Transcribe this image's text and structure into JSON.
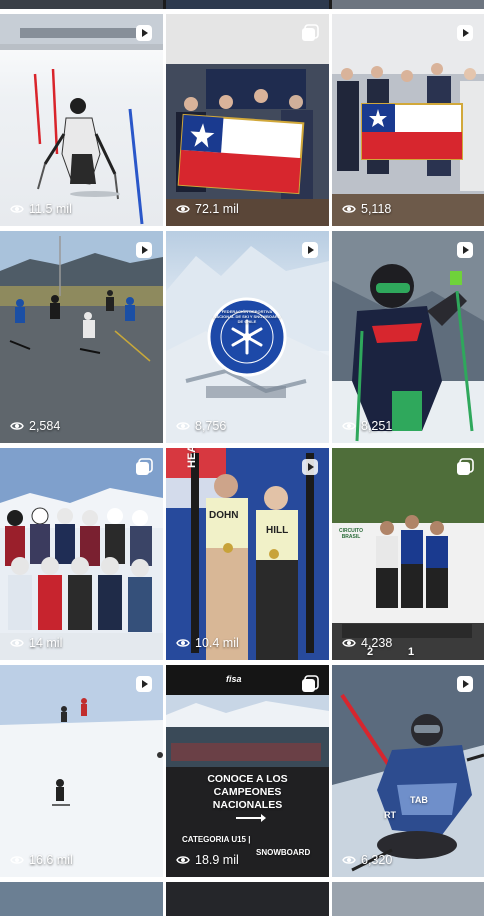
{
  "grid": {
    "tiles": [
      {
        "views": "11.5 mil",
        "badge": "reel-icon",
        "bg": "#dde3ea"
      },
      {
        "views": "72.1 mil",
        "badge": "carousel-icon",
        "bg": "#2a3346"
      },
      {
        "views": "5,118",
        "badge": "reel-icon",
        "bg": "#c9ccd3"
      },
      {
        "views": "2,584",
        "badge": "reel-icon",
        "bg": "#6f7a82"
      },
      {
        "views": "8,756",
        "badge": "reel-icon",
        "bg": "#cfdcea"
      },
      {
        "views": "8,251",
        "badge": "reel-icon",
        "bg": "#3b4452"
      },
      {
        "views": "14 mil",
        "badge": "carousel-icon",
        "bg": "#8da6c6"
      },
      {
        "views": "10.4 mil",
        "badge": "reel-icon",
        "bg": "#2c4c99"
      },
      {
        "views": "4,238",
        "badge": "carousel-icon",
        "bg": "#5c7a45"
      },
      {
        "views": "16.6 mil",
        "badge": "reel-icon",
        "bg": "#c9d6e8"
      },
      {
        "views": "18.9 mil",
        "badge": "carousel-icon",
        "bg": "#1d1d1f"
      },
      {
        "views": "6,320",
        "badge": "reel-icon",
        "bg": "#4b5a6c"
      }
    ]
  },
  "overlays": {
    "federation_logo_text": "FEDERACIÓN DEPORTIVA NACIONAL DE SKI Y SNOWBOARD DE CHILE",
    "promo_line1": "CONOCE A LOS",
    "promo_line2": "CAMPEONES",
    "promo_line3": "NACIONALES",
    "promo_line4": "CATEGORIA U15 |",
    "promo_line5": "SNOWBOARD",
    "promo_logos": "fisa",
    "bib_head": "HEAD",
    "bib_name1": "DOHN",
    "bib_name2": "HILL",
    "circuito_text": "CIRCUITO BRASIL",
    "podium_1": "1",
    "podium_2": "2",
    "bib_rt": "RT",
    "bib_tab": "TAB"
  }
}
